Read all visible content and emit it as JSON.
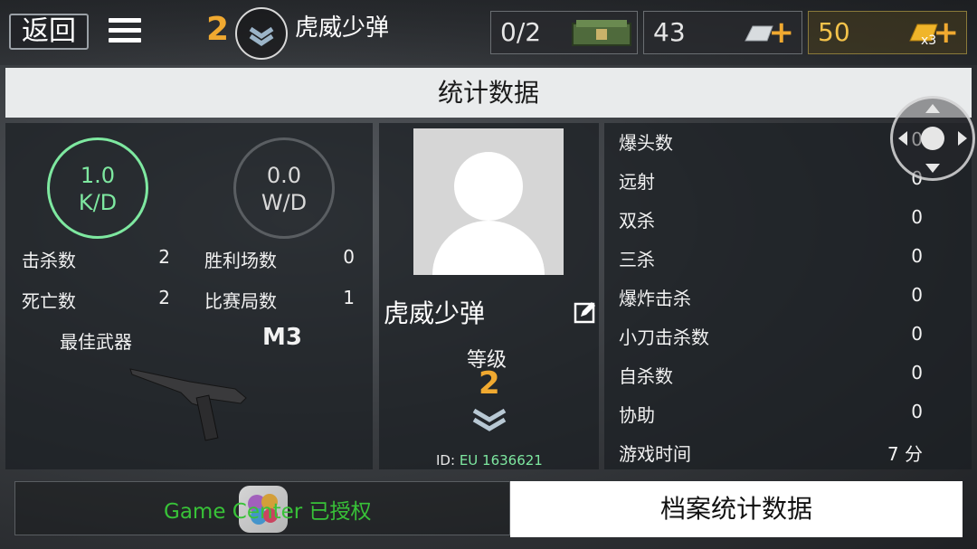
{
  "header": {
    "back_label": "返回",
    "rank_number": "2",
    "player_name": "虎威少弹",
    "crates": "0/2",
    "silver": "43",
    "gold": "50",
    "gold_multiplier": "x3"
  },
  "title": "统计数据",
  "left_panel": {
    "kd": {
      "value": "1.0",
      "label": "K/D"
    },
    "wd": {
      "value": "0.0",
      "label": "W/D"
    },
    "kills_label": "击杀数",
    "kills": "2",
    "wins_label": "胜利场数",
    "wins": "0",
    "deaths_label": "死亡数",
    "deaths": "2",
    "matches_label": "比赛局数",
    "matches": "1",
    "best_weapon_label": "最佳武器",
    "best_weapon": "M3"
  },
  "center_panel": {
    "player_name": "虎威少弹",
    "level_label": "等级",
    "level": "2",
    "id_prefix": "ID:",
    "id_value": "EU 1636621"
  },
  "right_panel": {
    "stats": [
      {
        "label": "爆头数",
        "value": "0"
      },
      {
        "label": "远射",
        "value": "0"
      },
      {
        "label": "双杀",
        "value": "0"
      },
      {
        "label": "三杀",
        "value": "0"
      },
      {
        "label": "爆炸击杀",
        "value": "0"
      },
      {
        "label": "小刀击杀数",
        "value": "0"
      },
      {
        "label": "自杀数",
        "value": "0"
      },
      {
        "label": "协助",
        "value": "0"
      },
      {
        "label": "游戏时间",
        "value": "7 分"
      }
    ]
  },
  "footer": {
    "game_center_text": "Game Center 已授权",
    "profile_stats_label": "档案统计数据"
  },
  "colors": {
    "accent_orange": "#f0a930",
    "kd_green": "#7ee8a0",
    "gc_green": "#38c238"
  }
}
